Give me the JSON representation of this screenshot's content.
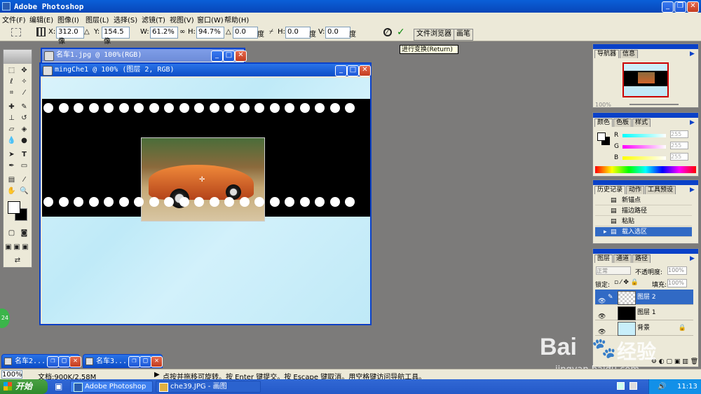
{
  "app": {
    "title": "Adobe Photoshop"
  },
  "menu": [
    "文件(F)",
    "编辑(E)",
    "图像(I)",
    "图层(L)",
    "选择(S)",
    "滤镜(T)",
    "视图(V)",
    "窗口(W)",
    "帮助(H)"
  ],
  "options": {
    "x_label": "X:",
    "x_value": "312.0 像",
    "y_label": "Y:",
    "y_value": "154.5 像",
    "w_label": "W:",
    "w_value": "61.2%",
    "h_label": "H:",
    "h_value": "94.7%",
    "rot_value": "0.0",
    "rot_unit": "度",
    "hskew_label": "H:",
    "hskew_value": "0.0",
    "hskew_unit": "度",
    "vskew_label": "V:",
    "vskew_value": "0.0",
    "vskew_unit": "度",
    "cancel_icon": "cancel-icon",
    "commit_icon": "check-icon",
    "tab_file_browser": "文件浏览器",
    "tab_brushes": "画笔",
    "tooltip": "进行变换(Return)"
  },
  "documents": {
    "back": {
      "title": "名车1.jpg @ 100%(RGB)"
    },
    "front": {
      "title": "mingChe1 @ 100% (图层 2, RGB)"
    }
  },
  "minimized": [
    {
      "title": "名车2..."
    },
    {
      "title": "名车3..."
    }
  ],
  "navigator": {
    "tabs": [
      "导航器",
      "信息"
    ],
    "zoom": "100%"
  },
  "color": {
    "tabs": [
      "颜色",
      "色板",
      "样式"
    ],
    "r_label": "R",
    "r_value": "255",
    "g_label": "G",
    "g_value": "255",
    "b_label": "B",
    "b_value": "255"
  },
  "history": {
    "tabs": [
      "历史记录",
      "动作",
      "工具预设"
    ],
    "items": [
      "新锚点",
      "描边路径",
      "粘贴",
      "载入选区"
    ]
  },
  "layers": {
    "tabs": [
      "图层",
      "通道",
      "路径"
    ],
    "blend_mode": "正常",
    "opacity_label": "不透明度:",
    "opacity_value": "100%",
    "lock_label": "锁定:",
    "fill_label": "填充:",
    "fill_value": "100%",
    "items": [
      "图层 2",
      "图层 1",
      "背景"
    ]
  },
  "status": {
    "zoom": "100%",
    "doc": "文档:900K/2.58M",
    "hint": "点按并拖移可旋转。按 Enter 键提交。按 Escape 键取消。用空格键访问导航工具。"
  },
  "taskbar": {
    "start": "开始",
    "tasks": [
      "Adobe Photoshop",
      "che39.JPG - 画图"
    ],
    "clock": "11:13"
  },
  "badge": "24",
  "watermark": {
    "logo": "Bai",
    "logo2": "经验",
    "url": "jingyan.baidu.com"
  }
}
